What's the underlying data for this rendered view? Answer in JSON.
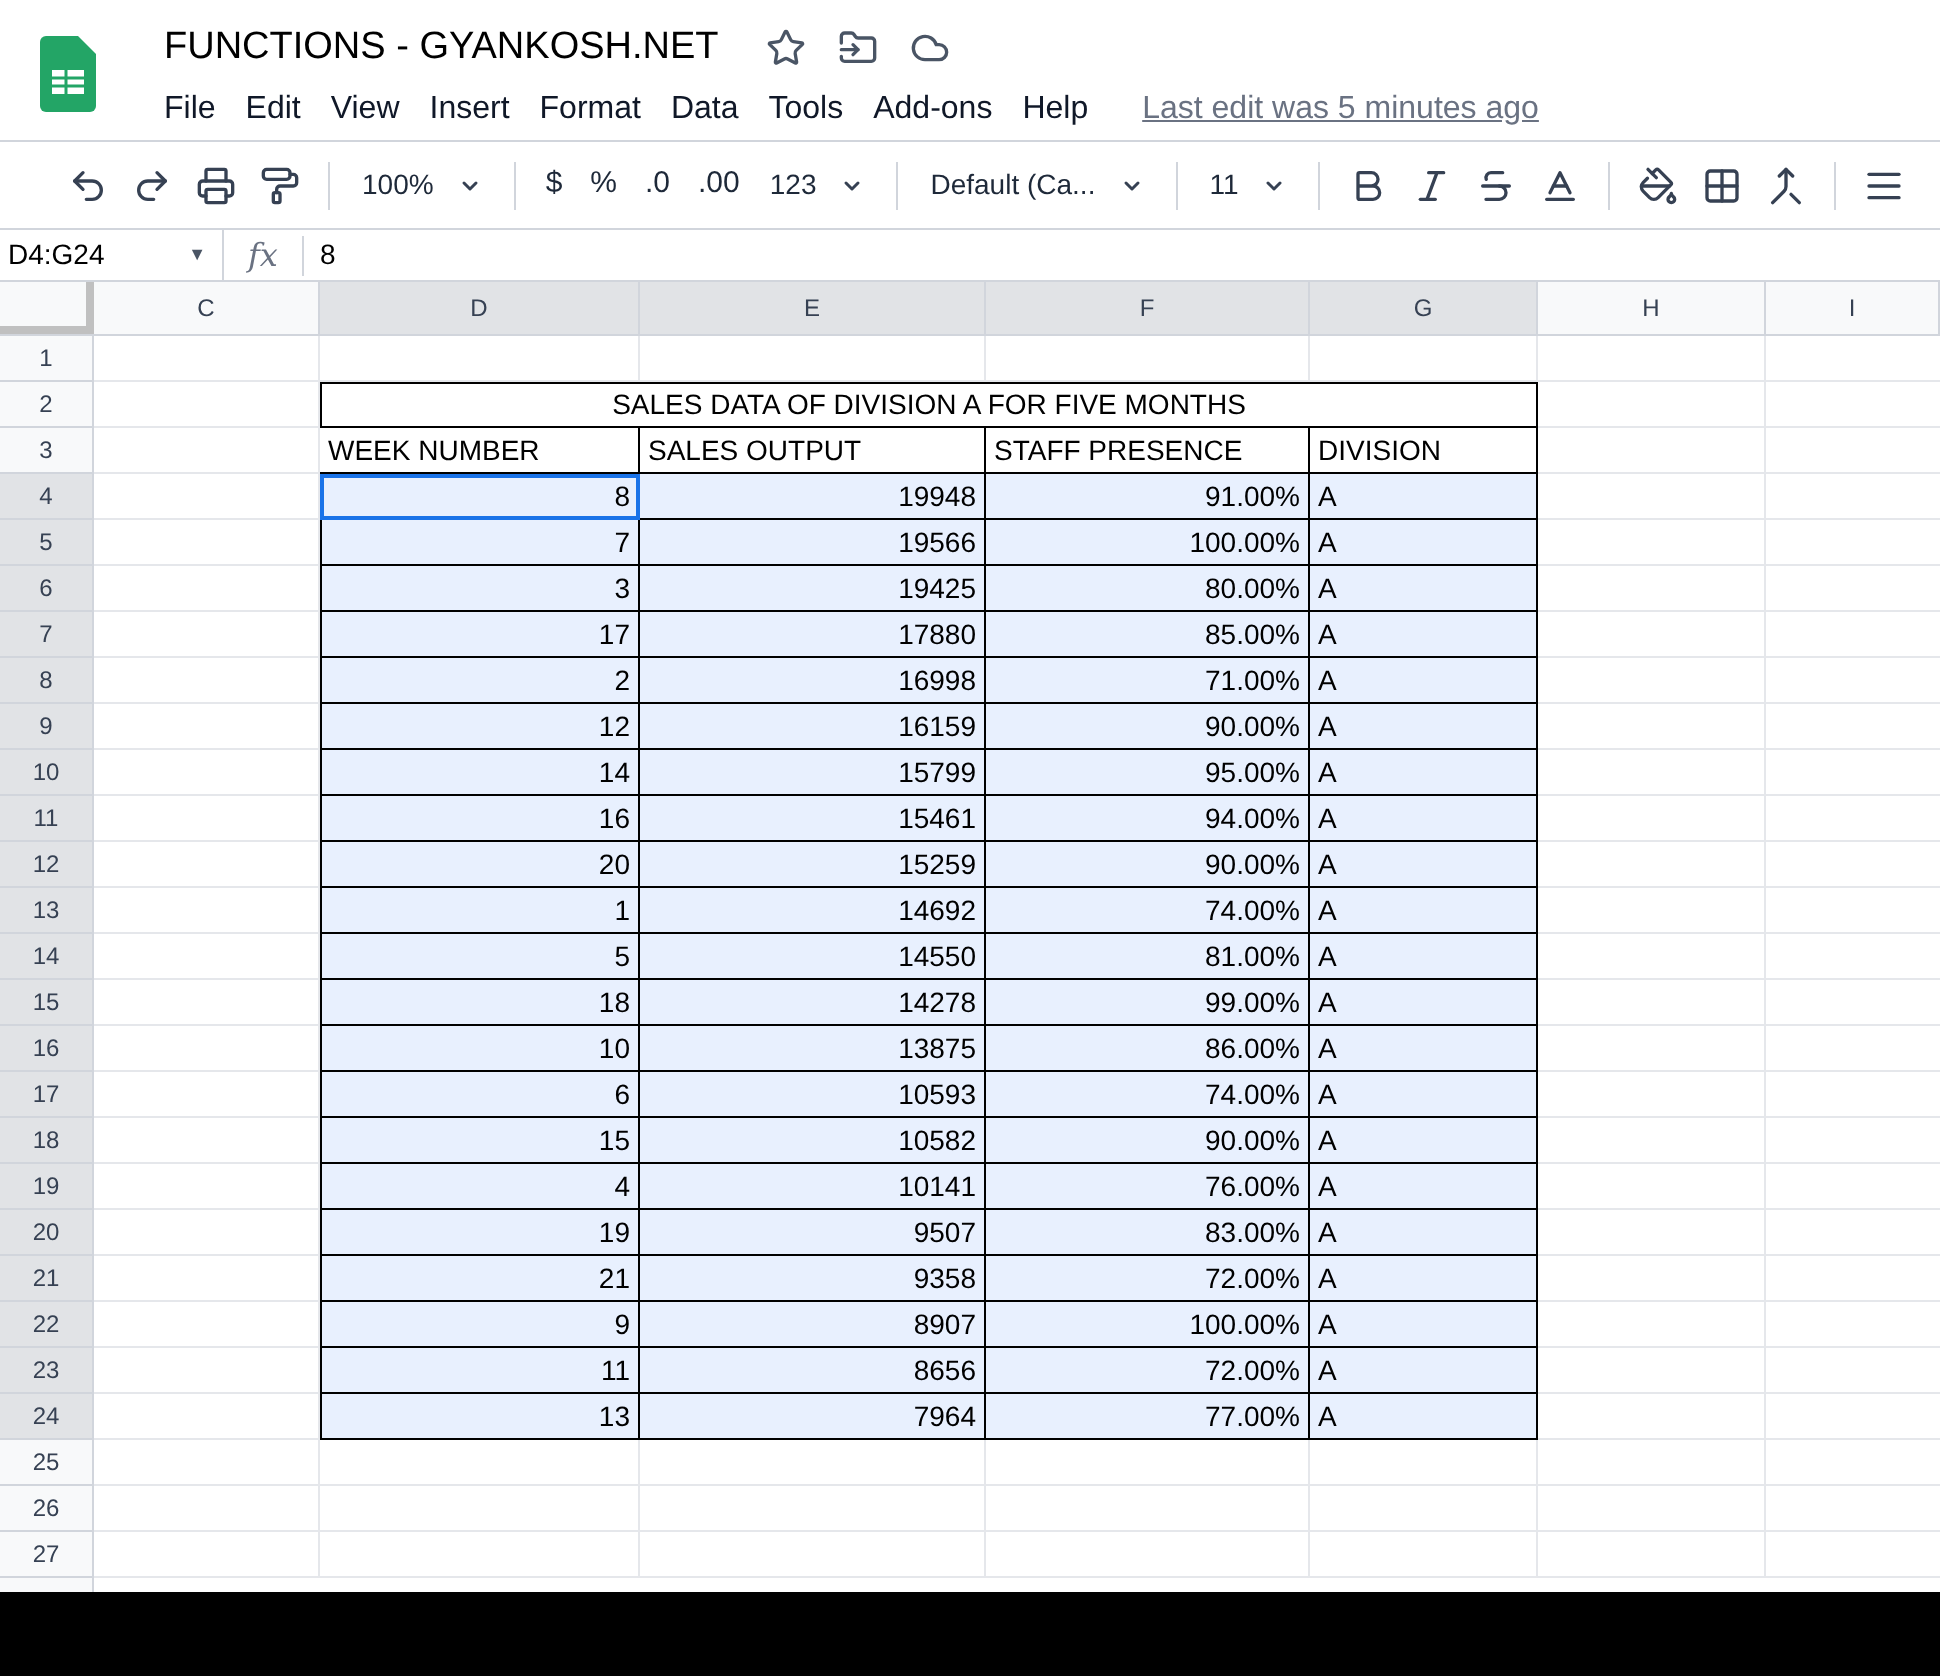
{
  "document": {
    "title": "FUNCTIONS - GYANKOSH.NET"
  },
  "menu": [
    "File",
    "Edit",
    "View",
    "Insert",
    "Format",
    "Data",
    "Tools",
    "Add-ons",
    "Help"
  ],
  "last_edit": "Last edit was 5 minutes ago",
  "toolbar": [
    {
      "kind": "icon"
    },
    {
      "kind": "icon"
    },
    {
      "kind": "icon"
    },
    {
      "kind": "icon"
    },
    {
      "kind": "sep"
    },
    {
      "kind": "dropdown",
      "label": "100%"
    },
    {
      "kind": "sep"
    },
    {
      "kind": "text",
      "label": "$"
    },
    {
      "kind": "text",
      "label": "%"
    },
    {
      "kind": "text",
      "label": ".0"
    },
    {
      "kind": "text",
      "label": ".00"
    },
    {
      "kind": "dropdown",
      "label": "123"
    },
    {
      "kind": "sep"
    },
    {
      "kind": "dropdown",
      "label": "Default (Ca..."
    },
    {
      "kind": "sep"
    },
    {
      "kind": "dropdown",
      "label": "11"
    },
    {
      "kind": "sep"
    },
    {
      "kind": "icon"
    },
    {
      "kind": "icon"
    },
    {
      "kind": "icon"
    },
    {
      "kind": "icon"
    },
    {
      "kind": "sep"
    },
    {
      "kind": "icon"
    },
    {
      "kind": "icon"
    },
    {
      "kind": "icon"
    },
    {
      "kind": "sep"
    },
    {
      "kind": "icon"
    }
  ],
  "name_box": "D4:G24",
  "name_box_caret": "▼",
  "function_label": "fx",
  "formula": "8",
  "columns": [
    "C",
    "D",
    "E",
    "F",
    "G",
    "H",
    "I"
  ],
  "table_title": "SALES DATA OF DIVISION A FOR FIVE MONTHS",
  "table_headers": [
    "WEEK NUMBER",
    "SALES OUTPUT",
    "STAFF PRESENCE",
    "DIVISION"
  ],
  "rows": [
    {
      "cells": [
        "8",
        "19948",
        "91.00%",
        "A"
      ],
      "selected": true,
      "active": true
    },
    {
      "cells": [
        "7",
        "19566",
        "100.00%",
        "A"
      ],
      "selected": true,
      "active": false
    },
    {
      "cells": [
        "3",
        "19425",
        "80.00%",
        "A"
      ],
      "selected": true,
      "active": false
    },
    {
      "cells": [
        "17",
        "17880",
        "85.00%",
        "A"
      ],
      "selected": true,
      "active": false
    },
    {
      "cells": [
        "2",
        "16998",
        "71.00%",
        "A"
      ],
      "selected": true,
      "active": false
    },
    {
      "cells": [
        "12",
        "16159",
        "90.00%",
        "A"
      ],
      "selected": true,
      "active": false
    },
    {
      "cells": [
        "14",
        "15799",
        "95.00%",
        "A"
      ],
      "selected": true,
      "active": false
    },
    {
      "cells": [
        "16",
        "15461",
        "94.00%",
        "A"
      ],
      "selected": true,
      "active": false
    },
    {
      "cells": [
        "20",
        "15259",
        "90.00%",
        "A"
      ],
      "selected": true,
      "active": false
    },
    {
      "cells": [
        "1",
        "14692",
        "74.00%",
        "A"
      ],
      "selected": true,
      "active": false
    },
    {
      "cells": [
        "5",
        "14550",
        "81.00%",
        "A"
      ],
      "selected": true,
      "active": false
    },
    {
      "cells": [
        "18",
        "14278",
        "99.00%",
        "A"
      ],
      "selected": true,
      "active": false
    },
    {
      "cells": [
        "10",
        "13875",
        "86.00%",
        "A"
      ],
      "selected": true,
      "active": false
    },
    {
      "cells": [
        "6",
        "10593",
        "74.00%",
        "A"
      ],
      "selected": true,
      "active": false
    },
    {
      "cells": [
        "15",
        "10582",
        "90.00%",
        "A"
      ],
      "selected": true,
      "active": false
    },
    {
      "cells": [
        "4",
        "10141",
        "76.00%",
        "A"
      ],
      "selected": true,
      "active": false
    },
    {
      "cells": [
        "19",
        "9507",
        "83.00%",
        "A"
      ],
      "selected": true,
      "active": false
    },
    {
      "cells": [
        "21",
        "9358",
        "72.00%",
        "A"
      ],
      "selected": true,
      "active": false
    },
    {
      "cells": [
        "9",
        "8907",
        "100.00%",
        "A"
      ],
      "selected": true,
      "active": false
    },
    {
      "cells": [
        "11",
        "8656",
        "72.00%",
        "A"
      ],
      "selected": true,
      "active": false
    },
    {
      "cells": [
        "13",
        "7964",
        "77.00%",
        "A"
      ],
      "selected": true,
      "active": false
    }
  ],
  "row_numbers": [
    "1",
    "2",
    "3",
    "4",
    "5",
    "6",
    "7",
    "8",
    "9",
    "10",
    "11",
    "12",
    "13",
    "14",
    "15",
    "16",
    "17",
    "18",
    "19",
    "20",
    "21",
    "22",
    "23",
    "24",
    "25",
    "26",
    "27"
  ]
}
